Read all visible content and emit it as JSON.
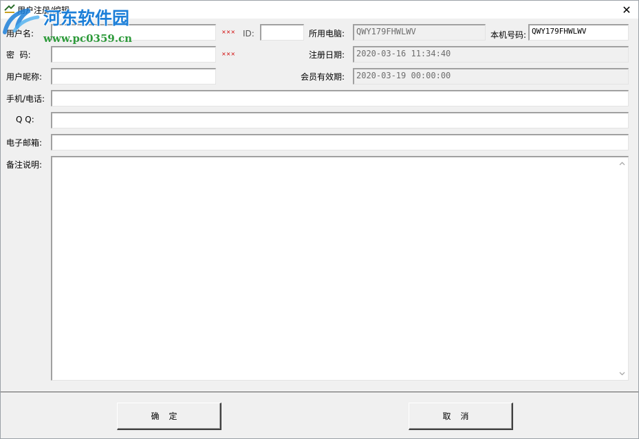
{
  "window": {
    "title": "用户注册/编辑",
    "close_glyph": "✕"
  },
  "watermark": {
    "title": "河东软件园",
    "url": "www.pc0359.cn"
  },
  "form": {
    "username": {
      "label": "用户名:",
      "value": "",
      "required_mark": "×××"
    },
    "id": {
      "label": "ID:",
      "value": ""
    },
    "computer": {
      "label": "所用电脑:",
      "value": "QWY179FHWLWV"
    },
    "machine_code": {
      "label": "本机号码:",
      "value": "QWY179FHWLWV"
    },
    "password": {
      "label": "密  码:",
      "value": "",
      "required_mark": "×××"
    },
    "register_date": {
      "label": "注册日期:",
      "value": "2020-03-16 11:34:40"
    },
    "nickname": {
      "label": "用户昵称:",
      "value": ""
    },
    "expiry": {
      "label": "会员有效期:",
      "value": "2020-03-19 00:00:00"
    },
    "phone": {
      "label": "手机/电话:",
      "value": ""
    },
    "qq": {
      "label": "Q Q:",
      "value": ""
    },
    "email": {
      "label": "电子邮箱:",
      "value": ""
    },
    "notes": {
      "label": "备注说明:",
      "value": ""
    }
  },
  "buttons": {
    "ok": "确定",
    "cancel": "取消"
  },
  "colors": {
    "required_mark": "#d00000",
    "watermark_blue": "#1c7fd8",
    "watermark_green": "#2d9a3a"
  }
}
